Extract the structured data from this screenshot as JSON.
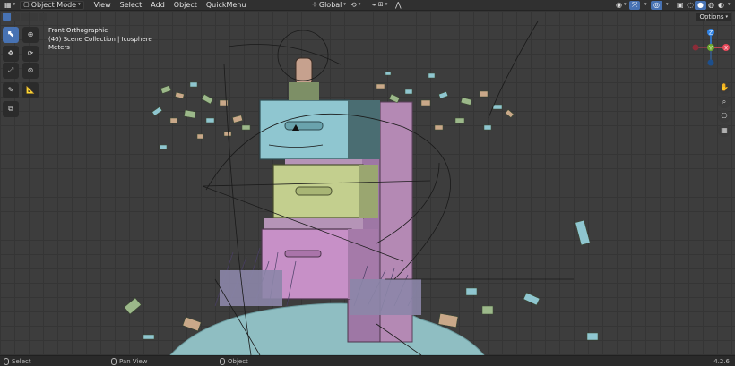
{
  "header": {
    "editor_icon": "view3d-icon",
    "mode_label": "Object Mode",
    "menus": [
      "View",
      "Select",
      "Add",
      "Object",
      "QuickMenu"
    ],
    "transform_orientation": "Global",
    "options_label": "Options"
  },
  "overlay": {
    "view_name": "Front Orthographic",
    "collection": "(46) Scene Collection | Icosphere",
    "units": "Meters"
  },
  "gizmo": {
    "z_label": "Z",
    "y_label": "Y",
    "x_label": "X"
  },
  "statusbar": {
    "left_action": "Select",
    "mid_action": "Pan View",
    "right_action": "Object",
    "version": "4.2.6"
  },
  "colors": {
    "accent": "#4772b3",
    "axis_x": "#e8485a",
    "axis_y": "#6ea92e",
    "axis_z": "#2f83e6",
    "cabinet_top": "#8fc6d0",
    "cabinet_mid": "#c3cf8e",
    "cabinet_bottom": "#c790c7"
  }
}
